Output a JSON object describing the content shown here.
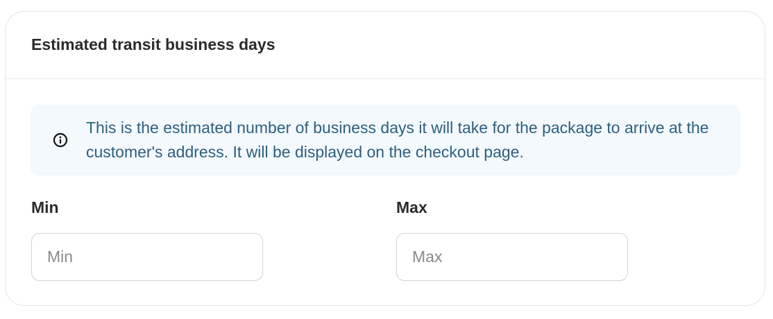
{
  "section": {
    "title": "Estimated transit business days"
  },
  "info": {
    "icon": "info-circle-icon",
    "text": "This is the estimated number of business days it will take for the package to arrive at the customer's address. It will be displayed on the checkout page."
  },
  "fields": {
    "min": {
      "label": "Min",
      "value": "",
      "placeholder": "Min"
    },
    "max": {
      "label": "Max",
      "value": "",
      "placeholder": "Max"
    }
  },
  "colors": {
    "info_background": "#f3f9fd",
    "info_text": "#2f5f7d",
    "border": "#e4e4e7"
  }
}
